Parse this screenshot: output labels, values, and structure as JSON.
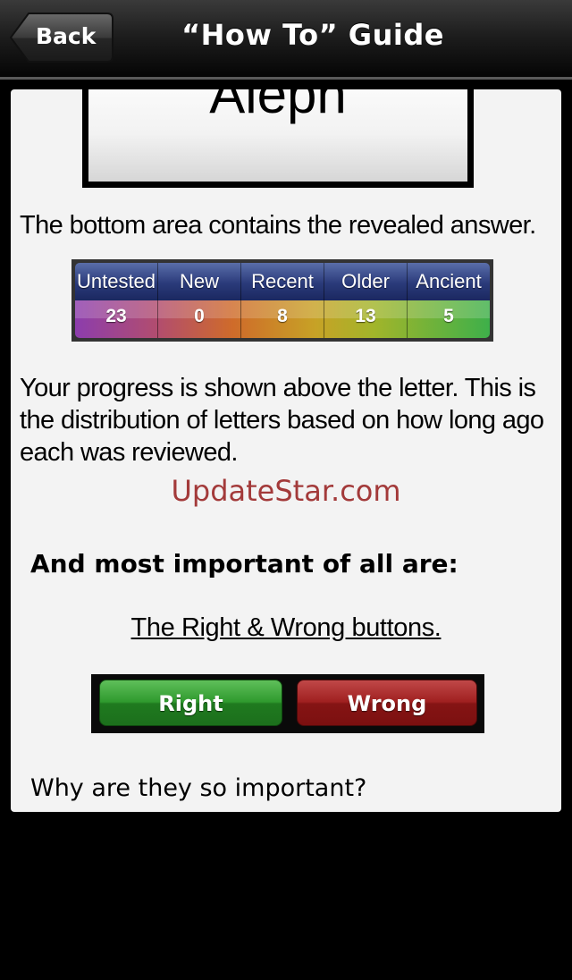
{
  "navbar": {
    "back_label": "Back",
    "title": "“How To” Guide"
  },
  "letter_card": {
    "letter": "Aleph"
  },
  "content": {
    "answer_text": "The bottom area contains the revealed answer.",
    "progress_text": "Your progress is shown above the letter. This is the distribution of letters based on how long ago each was reviewed.",
    "watermark": "UpdateStar.com",
    "section_heading": "And most important of all are:",
    "link_text": "The Right & Wrong buttons.",
    "question_text": "Why are they so important?"
  },
  "progress_table": {
    "headers": [
      "Untested",
      "New",
      "Recent",
      "Older",
      "Ancient"
    ],
    "values": [
      "23",
      "0",
      "8",
      "13",
      "5"
    ]
  },
  "demo_buttons": {
    "right_label": "Right",
    "wrong_label": "Wrong"
  },
  "colors": {
    "right_button": "#2f9a2e",
    "wrong_button": "#a02020",
    "header_blue": "#2a3a7a",
    "watermark": "#a33a3a"
  }
}
